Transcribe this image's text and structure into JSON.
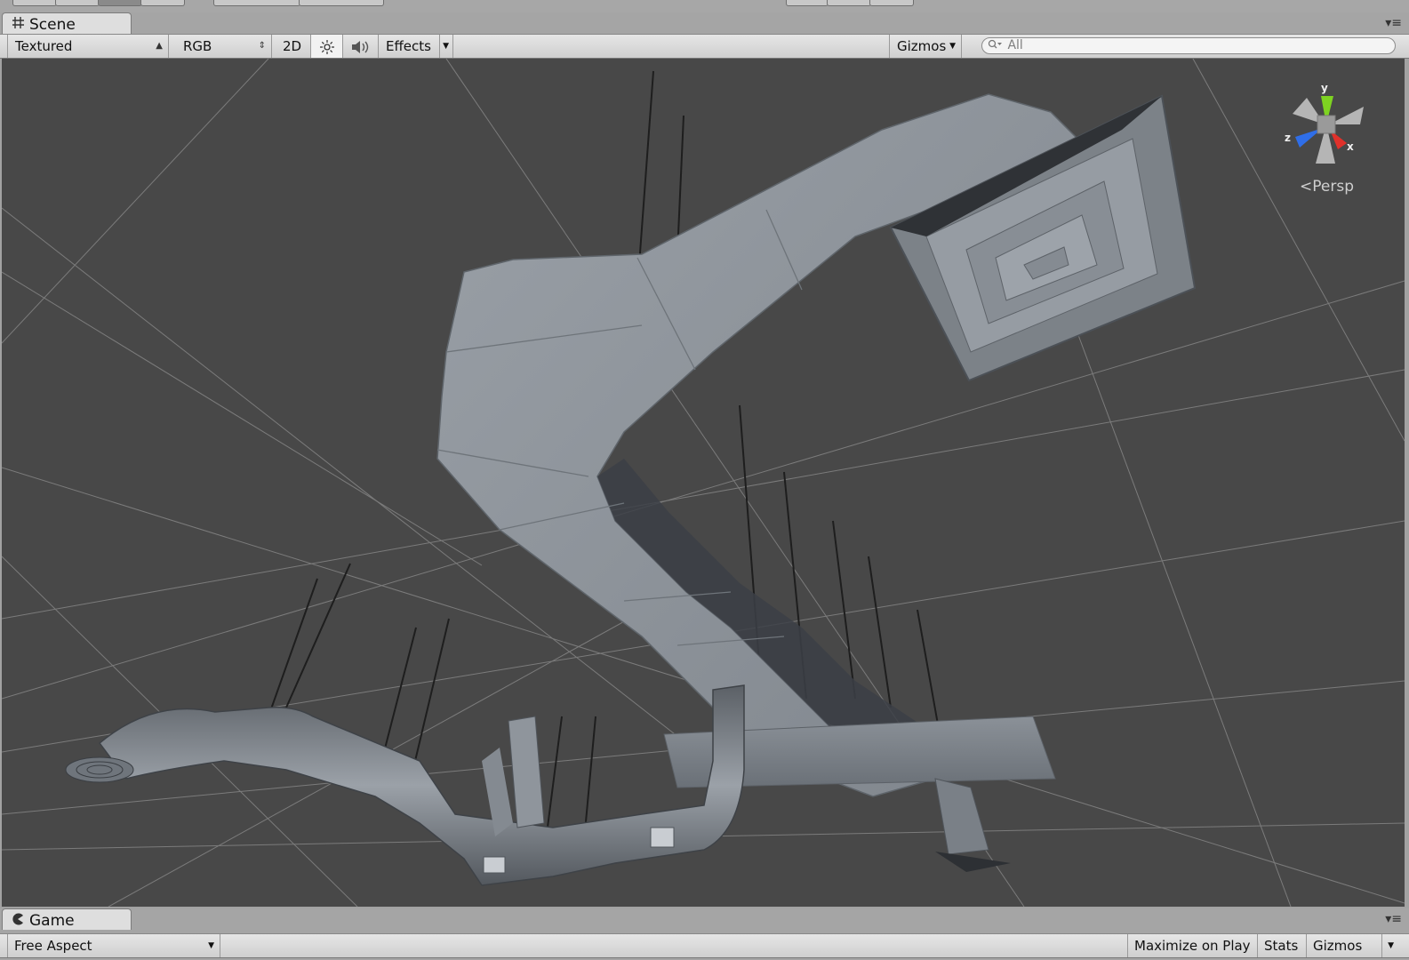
{
  "scene_tab": {
    "label": "Scene"
  },
  "scene_toolbar": {
    "draw_mode": "Textured",
    "render_mode": "RGB",
    "mode_2d": "2D",
    "effects": "Effects",
    "gizmos": "Gizmos",
    "search_value": "All"
  },
  "viewport": {
    "projection_label": "Persp",
    "axis_labels": {
      "y": "y",
      "z": "z",
      "x": "x"
    },
    "background_color": "#484848",
    "grid_color": "#8d8d8d",
    "axis_colors": {
      "y": "#7ed321",
      "z": "#2f6ee8",
      "x": "#e0312b"
    }
  },
  "game_tab": {
    "label": "Game"
  },
  "game_toolbar": {
    "aspect": "Free Aspect",
    "maximize": "Maximize on Play",
    "stats": "Stats",
    "gizmos": "Gizmos"
  },
  "icons": {
    "scene_tab_icon": "grid-icon",
    "game_tab_icon": "pacman-icon",
    "lighting_icon": "sun-icon",
    "audio_icon": "speaker-icon",
    "search_icon": "magnifier-icon",
    "panel_menu_icon": "menu-icon"
  }
}
